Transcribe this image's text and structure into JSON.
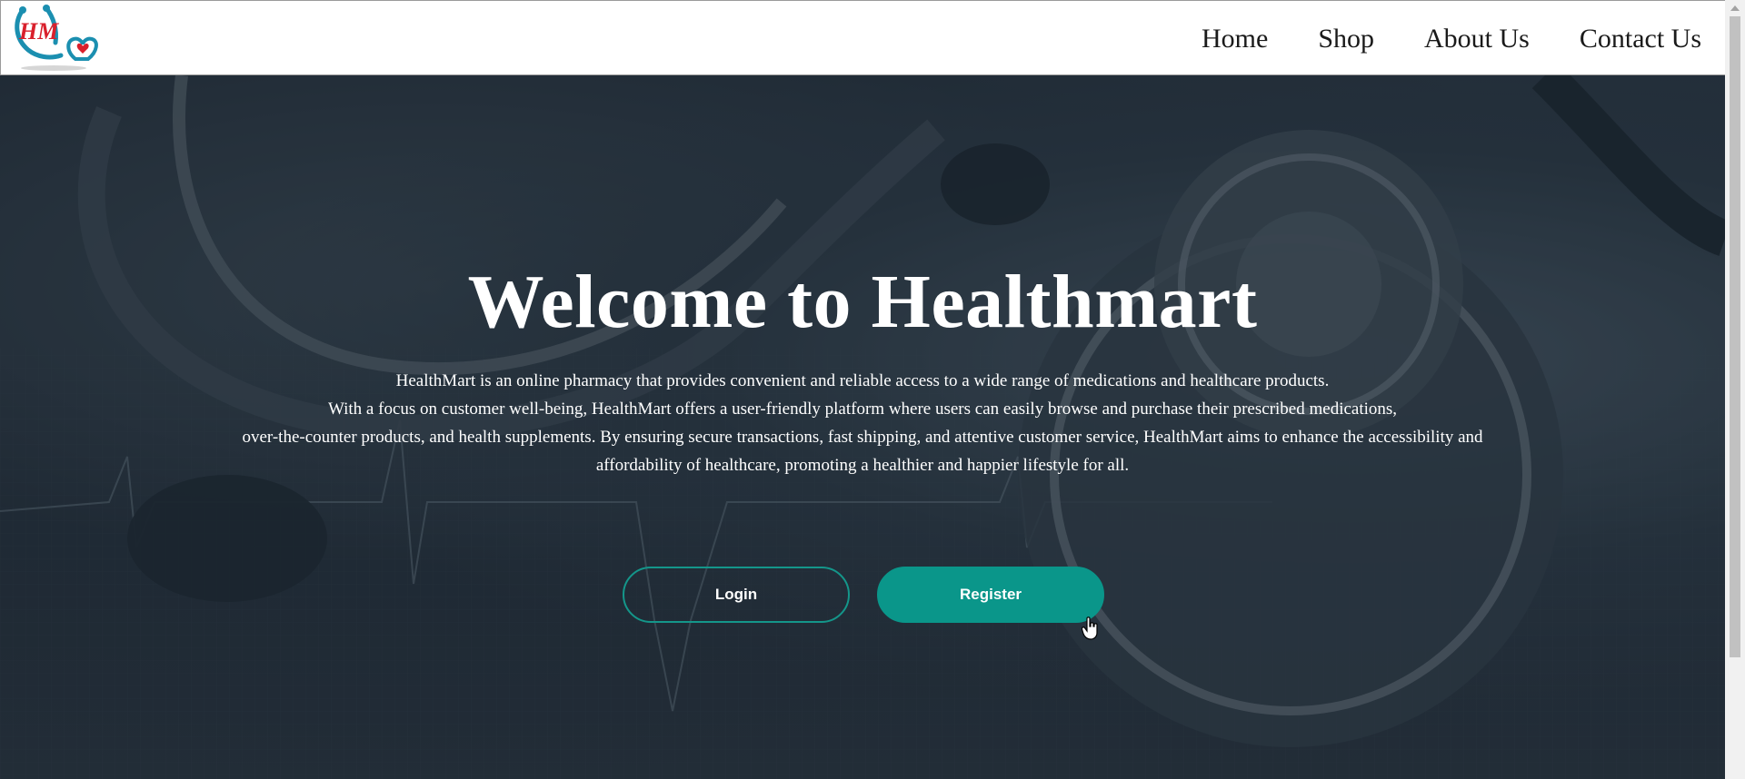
{
  "header": {
    "logo_text": "HM",
    "nav": [
      {
        "label": "Home"
      },
      {
        "label": "Shop"
      },
      {
        "label": "About Us"
      },
      {
        "label": "Contact Us"
      }
    ]
  },
  "hero": {
    "title": "Welcome to Healthmart",
    "description_lines": [
      "HealthMart is an online pharmacy that provides convenient and reliable access to a wide range of medications and healthcare products.",
      "With a focus on customer well-being, HealthMart offers a user-friendly platform where users can easily browse and purchase their prescribed medications,",
      "over-the-counter products, and health supplements. By ensuring secure transactions, fast shipping, and attentive customer service, HealthMart aims to enhance the accessibility and",
      "affordability of healthcare, promoting a healthier and happier lifestyle for all."
    ],
    "login_label": "Login",
    "register_label": "Register"
  },
  "colors": {
    "accent": "#0a968a",
    "logo_red": "#d9202c",
    "logo_teal": "#1b8fb0"
  }
}
